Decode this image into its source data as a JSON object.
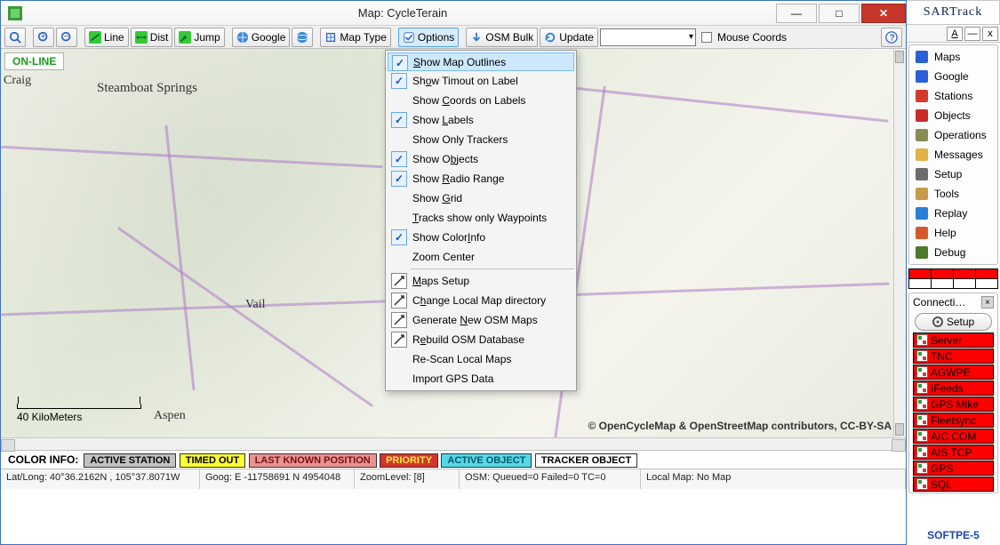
{
  "window": {
    "title": "Map: CycleTerain",
    "minimize": "—",
    "maximize": "□",
    "close": "✕"
  },
  "toolbar": {
    "line": "Line",
    "dist": "Dist",
    "jump": "Jump",
    "google": "Google",
    "maptype": "Map Type",
    "options": "Options",
    "osmbulk": "OSM Bulk",
    "update": "Update",
    "mousecoords": "Mouse Coords"
  },
  "map": {
    "online": "ON-LINE",
    "towns": {
      "craig": "Craig",
      "steamboat": "Steamboat Springs",
      "vail": "Vail",
      "aspen": "Aspen"
    },
    "scale": "40 KiloMeters",
    "attrib": "© OpenCycleMap & OpenStreetMap contributors, CC-BY-SA"
  },
  "options_menu": [
    {
      "label": "Show Map Outlines",
      "u": "S",
      "checked": true,
      "hl": true
    },
    {
      "label": "Show Timout on Label",
      "u": "o",
      "checked": true
    },
    {
      "label": "Show Coords on Labels",
      "u": "C"
    },
    {
      "label": "Show Labels",
      "u": "L",
      "checked": true
    },
    {
      "label": "Show Only Trackers"
    },
    {
      "label": "Show Objects",
      "u": "b",
      "checked": true
    },
    {
      "label": "Show Radio Range",
      "u": "R",
      "checked": true
    },
    {
      "label": "Show Grid",
      "u": "G"
    },
    {
      "label": "Tracks show only Waypoints",
      "u": "T"
    },
    {
      "label": "Show ColorInfo",
      "u": "I",
      "checked": true
    },
    {
      "label": "Zoom Center"
    },
    {
      "hr": true
    },
    {
      "label": "Maps Setup",
      "u": "M",
      "icon": true
    },
    {
      "label": "Change Local Map directory",
      "u": "h",
      "icon": true
    },
    {
      "label": "Generate New OSM Maps",
      "u": "N",
      "icon": true
    },
    {
      "label": "Rebuild OSM Database",
      "u": "e",
      "icon": true
    },
    {
      "label": "Re-Scan Local Maps"
    },
    {
      "label": "Import GPS Data"
    }
  ],
  "colorinfo": {
    "label": "COLOR INFO:",
    "chips": [
      {
        "text": "ACTIVE STATION",
        "bg": "#c2c2c2",
        "fg": "#000"
      },
      {
        "text": "TIMED OUT",
        "bg": "#ffff33",
        "fg": "#000"
      },
      {
        "text": "LAST KNOWN POSITION",
        "bg": "#e99393",
        "fg": "#7a1010"
      },
      {
        "text": "PRIORITY",
        "bg": "#d4342e",
        "fg": "#ffef3b"
      },
      {
        "text": "ACTIVE OBJECT",
        "bg": "#55d9e6",
        "fg": "#06576a"
      },
      {
        "text": "TRACKER OBJECT",
        "bg": "#ffffff",
        "fg": "#000"
      }
    ]
  },
  "status": {
    "latlong": "Lat/Long: 40°36.2162N , 105°37.8071W",
    "goog": "Goog: E -11758691 N 4954048",
    "zoom": "ZoomLevel: [8]",
    "osm": "OSM: Queued=0 Failed=0 TC=0",
    "local": "Local Map: No Map"
  },
  "sartrack": {
    "title": "SARTrack",
    "nav": [
      {
        "label": "Maps",
        "color": "#2a5fd6"
      },
      {
        "label": "Google",
        "color": "#2a5fd6"
      },
      {
        "label": "Stations",
        "color": "#d43a2a"
      },
      {
        "label": "Objects",
        "color": "#c92a2a"
      },
      {
        "label": "Operations",
        "color": "#8a8a55"
      },
      {
        "label": "Messages",
        "color": "#e0b24a"
      },
      {
        "label": "Setup",
        "color": "#6b6b6b"
      },
      {
        "label": "Tools",
        "color": "#c89a4a"
      },
      {
        "label": "Replay",
        "color": "#2a7fd6"
      },
      {
        "label": "Help",
        "color": "#d65a2a"
      },
      {
        "label": "Debug",
        "color": "#4a7a2a"
      }
    ],
    "connections": {
      "title": "Connecti…",
      "setup": "Setup",
      "items": [
        "Server",
        "TNC",
        "AGWPE",
        "IFeeds",
        "GPS Mike",
        "Fleetsync",
        "AIC COM",
        "AIS TCP",
        "GPS",
        "SQL"
      ]
    },
    "footer": "SOFTPE-5"
  }
}
